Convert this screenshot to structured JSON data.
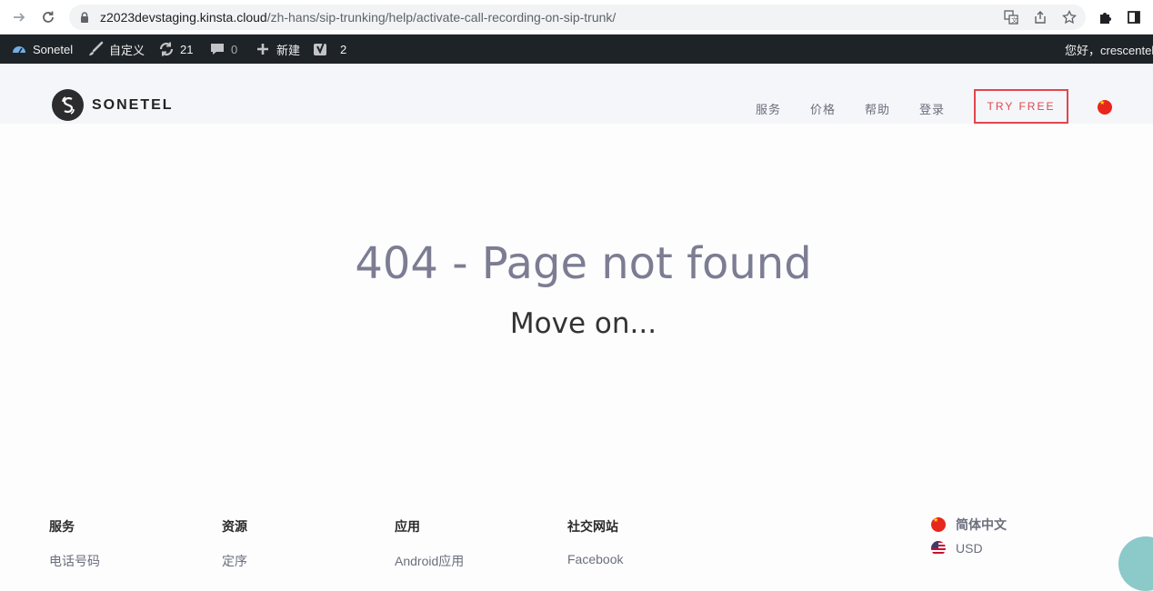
{
  "browser": {
    "url_host": "z2023devstaging.kinsta.cloud",
    "url_path": "/zh-hans/sip-trunking/help/activate-call-recording-on-sip-trunk/"
  },
  "adminbar": {
    "site_name": "Sonetel",
    "customize": "自定义",
    "updates_count": "21",
    "comments_count": "0",
    "new_label": "新建",
    "yoast_count": "2",
    "greeting": "您好，crescentek"
  },
  "header": {
    "logo_text": "SONETEL",
    "nav": [
      "服务",
      "价格",
      "帮助",
      "登录"
    ],
    "cta": "TRY FREE"
  },
  "main": {
    "title": "404 - Page not found",
    "subtitle": "Move on..."
  },
  "footer": {
    "columns": [
      {
        "heading": "服务",
        "first_link": "电话号码"
      },
      {
        "heading": "资源",
        "first_link": "定序"
      },
      {
        "heading": "应用",
        "first_link": "Android应用"
      },
      {
        "heading": "社交网站",
        "first_link": "Facebook"
      }
    ],
    "language": "简体中文",
    "currency": "USD"
  },
  "colors": {
    "accent": "#e0474c",
    "admin_bar": "#1d2327",
    "title_gray": "#7c7d93"
  }
}
